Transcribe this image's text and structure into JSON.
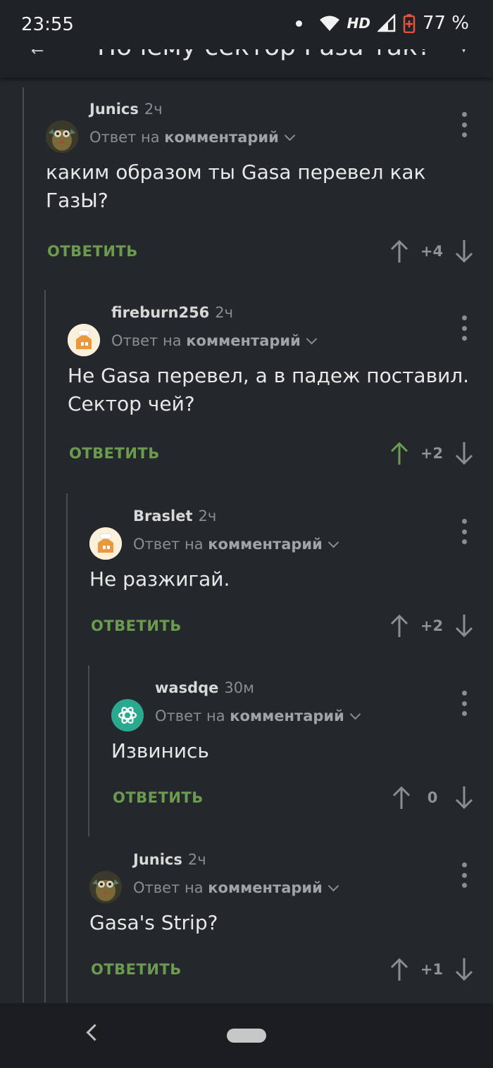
{
  "status": {
    "time": "23:55",
    "network": "HD",
    "battery": "77 %"
  },
  "appbar": {
    "title": "Почему сектор Газа так?"
  },
  "comments": [
    {
      "author": "Junics",
      "time": "2ч",
      "reply_prefix": "Ответ на",
      "reply_target": "комментарий",
      "text": "каким образом ты Gasa перевел как ГазЫ?",
      "reply_label": "ОТВЕТИТЬ",
      "score": "+4",
      "upvoted": false
    },
    {
      "author": "fireburn256",
      "time": "2ч",
      "reply_prefix": "Ответ на",
      "reply_target": "комментарий",
      "text": "Не Gasa перевел, а в падеж поставил. Сектор чей?",
      "reply_label": "ОТВЕТИТЬ",
      "score": "+2",
      "upvoted": true
    },
    {
      "author": "Braslet",
      "time": "2ч",
      "reply_prefix": "Ответ на",
      "reply_target": "комментарий",
      "text": "Не разжигай.",
      "reply_label": "ОТВЕТИТЬ",
      "score": "+2",
      "upvoted": false
    },
    {
      "author": "wasdqe",
      "time": "30м",
      "reply_prefix": "Ответ на",
      "reply_target": "комментарий",
      "text": "Извинись",
      "reply_label": "ОТВЕТИТЬ",
      "score": "0",
      "upvoted": false
    },
    {
      "author": "Junics",
      "time": "2ч",
      "reply_prefix": "Ответ на",
      "reply_target": "комментарий",
      "text": "Gasa's Strip?",
      "reply_label": "ОТВЕТИТЬ",
      "score": "+1",
      "upvoted": false
    }
  ],
  "icons": {
    "avatar_0": "owl-avatar-icon",
    "avatar_1": "house-avatar-icon",
    "avatar_2": "house-avatar-icon",
    "avatar_3": "openai-knot-avatar-icon",
    "avatar_4": "owl-avatar-icon"
  },
  "colors": {
    "background": "#24272b",
    "accent_green": "#6b9b4e",
    "muted": "#8a8e93"
  }
}
